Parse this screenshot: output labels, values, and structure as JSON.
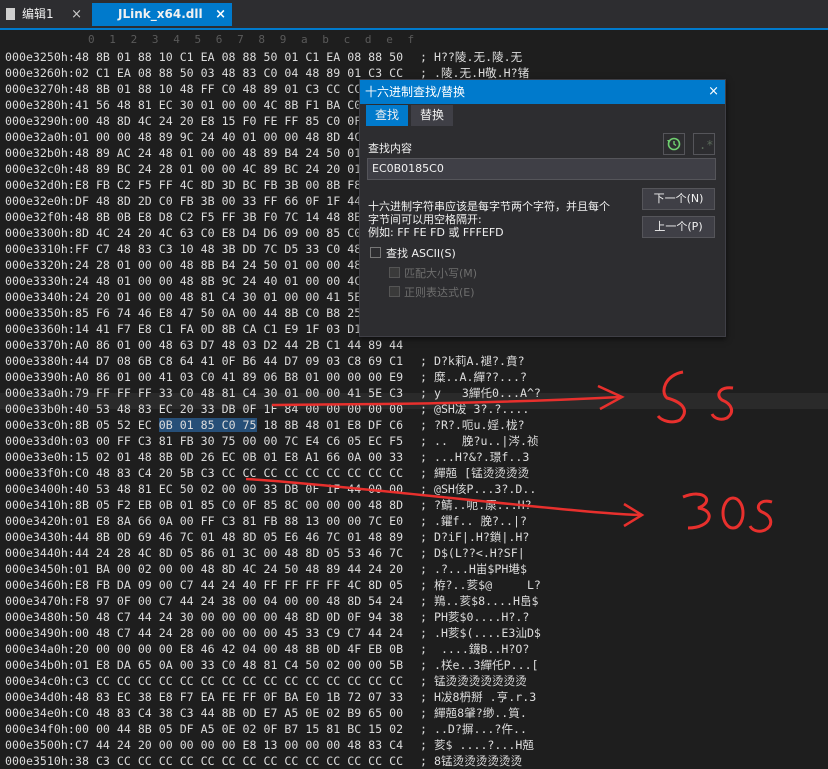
{
  "tabs": [
    {
      "label": "编辑1",
      "close": "×"
    },
    {
      "label": "JLink_x64.dll",
      "close": "×"
    }
  ],
  "ruler": [
    "0",
    "1",
    "2",
    "3",
    "4",
    "5",
    "6",
    "7",
    "8",
    "9",
    "a",
    "b",
    "c",
    "d",
    "e",
    "f"
  ],
  "rows": [
    {
      "o": "000e3250h:",
      "h": "48 8B 01 88 10 C1 EA 08 88 50 01 C1 EA 08 88 50",
      "a": "; H??陵.无.陵.无"
    },
    {
      "o": "000e3260h:",
      "h": "02 C1 EA 08 88 50 03 48 83 C0 04 48 89 01 C3 CC",
      "a": "; .陵.无.H敬.H?锗"
    },
    {
      "o": "000e3270h:",
      "h": "48 8B 01 88 10 48 FF C0 48 89 01 C3 CC CC CC CC",
      "a": ""
    },
    {
      "o": "000e3280h:",
      "h": "41 56 48 81 EC 30 01 00 00 4C 8B F1 BA C0 00 00",
      "a": ""
    },
    {
      "o": "000e3290h:",
      "h": "00 48 8D 4C 24 20 E8 15 F0 FE FF 85 C0 0F 84 00",
      "a": ""
    },
    {
      "o": "000e32a0h:",
      "h": "01 00 00 48 89 9C 24 40 01 00 00 48 8D 4C 24 20",
      "a": ""
    },
    {
      "o": "000e32b0h:",
      "h": "48 89 AC 24 48 01 00 00 48 89 B4 24 50 01 00 00",
      "a": ""
    },
    {
      "o": "000e32c0h:",
      "h": "48 89 BC 24 28 01 00 00 4C 89 BC 24 20 01 00 00",
      "a": ""
    },
    {
      "o": "000e32d0h:",
      "h": "E8 FB C2 F5 FF 4C 8D 3D BC FB 3B 00 8B F8 85 C0",
      "a": ""
    },
    {
      "o": "000e32e0h:",
      "h": "DF 48 8D 2D C0 FB 3B 00 33 FF 66 0F 1F 44 00 00",
      "a": ""
    },
    {
      "o": "000e32f0h:",
      "h": "48 8B 0B E8 D8 C2 F5 FF 3B F0 7C 14 48 8B 0B 8B",
      "a": ""
    },
    {
      "o": "000e3300h:",
      "h": "8D 4C 24 20 4C 63 C0 E8 D4 D6 09 00 85 C0 75 05",
      "a": ""
    },
    {
      "o": "000e3310h:",
      "h": "FF C7 48 83 C3 10 48 3B DD 7C D5 33 C0 48 8B 8C",
      "a": ""
    },
    {
      "o": "000e3320h:",
      "h": "24 28 01 00 00 48 8B B4 24 50 01 00 00 48 8B AC",
      "a": ""
    },
    {
      "o": "000e3330h:",
      "h": "24 48 01 00 00 48 8B 9C 24 40 01 00 00 4C 8B BC",
      "a": ""
    },
    {
      "o": "000e3340h:",
      "h": "24 20 01 00 00 48 81 C4 30 01 00 00 41 5E C3 CC",
      "a": ""
    },
    {
      "o": "000e3350h:",
      "h": "85 F6 74 46 E8 47 50 0A 00 44 8B C0 B8 25 49 92",
      "a": ""
    },
    {
      "o": "000e3360h:",
      "h": "14 41 F7 E8 C1 FA 0D 8B CA C1 E9 1F 03 D1 69 CA",
      "a": ""
    },
    {
      "o": "000e3370h:",
      "h": "A0 86 01 00 48 63 D7 48 03 D2 44 2B C1 44 89 44",
      "a": ""
    },
    {
      "o": "000e3380h:",
      "h": "44 D7 08 6B C8 64 41 0F B6 44 D7 09 03 C8 69 C1",
      "a": "; D?k莉A.褪?.賁?"
    },
    {
      "o": "000e3390h:",
      "h": "A0 86 01 00 41 03 C0 41 89 06 B8 01 00 00 00 E9",
      "a": "; 糜..A.繟??...?"
    },
    {
      "o": "000e33a0h:",
      "h": "79 FF FF FF 33 C0 48 81 C4 30 01 00 00 41 5E C3",
      "a": "; y   3繟仛0...A^?"
    },
    {
      "o": "000e33b0h:",
      "h": "40 53 48 83 EC 20 33 DB 0F 1F 84 00 00 00 00 00",
      "a": "; @SH冹 3?.?...."
    },
    {
      "o": "000e33c0h:",
      "h": "8B 05 52 EC 0B 01 85 C0 75 18 8B 48 01 E8 DF C6",
      "a": "; ?R?.呃u.婬.栊?"
    },
    {
      "o": "000e33d0h:",
      "h": "03 00 FF C3 81 FB 30 75 00 00 7C E4 C6 05 EC F5",
      "a": "; ..  脕?u..|涔.祯"
    },
    {
      "o": "000e33e0h:",
      "h": "15 02 01 48 8B 0D 26 EC 0B 01 E8 A1 66 0A 00 33",
      "a": "; ...H?&?.璟f..3"
    },
    {
      "o": "000e33f0h:",
      "h": "C0 48 83 C4 20 5B C3 CC CC CC CC CC CC CC CC CC",
      "a": "; 繟兡 [锰烫烫烫烫"
    },
    {
      "o": "000e3400h:",
      "h": "40 53 48 81 EC 50 02 00 00 33 DB 0F 1F 44 00 00",
      "a": "; @SH侅P...3?.D.."
    },
    {
      "o": "000e3410h:",
      "h": "8B 05 F2 EB 0B 01 85 C0 0F 85 8C 00 00 00 48 8D",
      "a": "; ?鲭..呃.厡...H?"
    },
    {
      "o": "000e3420h:",
      "h": "01 E8 8A 66 0A 00 FF C3 81 FB 88 13 00 00 7C E0",
      "a": "; .鑺f.. 脕?..|?"
    },
    {
      "o": "000e3430h:",
      "h": "44 8B 0D 69 46 7C 01 48 8D 05 E6 46 7C 01 48 89",
      "a": "; D?iF|.H?鎖|.H?"
    },
    {
      "o": "000e3440h:",
      "h": "44 24 28 4C 8D 05 86 01 3C 00 48 8D 05 53 46 7C",
      "a": "; D$(L??<.H?SF|"
    },
    {
      "o": "000e3450h:",
      "h": "01 BA 00 02 00 00 48 8D 4C 24 50 48 89 44 24 20",
      "a": "; .?...H峀$PH塂$"
    },
    {
      "o": "000e3460h:",
      "h": "E8 FB DA 09 00 C7 44 24 40 FF FF FF FF 4C 8D 05",
      "a": "; 栫?..荄$@     L?"
    },
    {
      "o": "000e3470h:",
      "h": "F8 97 0F 00 C7 44 24 38 00 04 00 00 48 8D 54 24",
      "a": "; 鴹..荄$8....H峊$"
    },
    {
      "o": "000e3480h:",
      "h": "50 48 C7 44 24 30 00 00 00 00 48 8D 0D 0F 94 38",
      "a": "; PH荄$0....H?.?"
    },
    {
      "o": "000e3490h:",
      "h": "00 48 C7 44 24 28 00 00 00 00 45 33 C9 C7 44 24",
      "a": "; .H荄$(....E3汕D$"
    },
    {
      "o": "000e34a0h:",
      "h": "20 00 00 00 00 E8 46 42 04 00 48 8B 0D 4F EB 0B",
      "a": ";  ....鑖B..H?O?"
    },
    {
      "o": "000e34b0h:",
      "h": "01 E8 DA 65 0A 00 33 C0 48 81 C4 50 02 00 00 5B",
      "a": "; .栚e..3繟仛P...["
    },
    {
      "o": "000e34c0h:",
      "h": "C3 CC CC CC CC CC CC CC CC CC CC CC CC CC CC CC",
      "a": "; 锰烫烫烫烫烫烫烫"
    },
    {
      "o": "000e34d0h:",
      "h": "48 83 EC 38 E8 F7 EA FE FF 0F BA E0 1B 72 07 33",
      "a": "; H冹8枬掰 .亨.r.3"
    },
    {
      "o": "000e34e0h:",
      "h": "C0 48 83 C4 38 C3 44 8B 0D E7 A5 0E 02 B9 65 00",
      "a": "; 繟兡8肈?缈..筫."
    },
    {
      "o": "000e34f0h:",
      "h": "00 00 44 8B 05 DF A5 0E 02 0F B7 15 81 BC 15 02",
      "a": "; ..D?摒...?仵.."
    },
    {
      "o": "000e3500h:",
      "h": "C7 44 24 20 00 00 00 00 E8 13 00 00 00 48 83 C4",
      "a": "; 荄$ ....?...H兡"
    },
    {
      "o": "000e3510h:",
      "h": "38 C3 CC CC CC CC CC CC CC CC CC CC CC CC CC CC",
      "a": "; 8锰烫烫烫烫烫烫"
    }
  ],
  "dialog": {
    "title": "十六进制查找/替换",
    "close": "×",
    "tab_find": "查找",
    "tab_replace": "替换",
    "find_label": "查找内容",
    "find_value": "EC0B0185C0",
    "help": "十六进制字符串应该是每字节两个字符，并且每个字节间可以用空格隔开:",
    "example": "例如: FF FE FD 或 FFFEFD",
    "next_button": "下一个(N)",
    "prev_button": "上一个(P)",
    "opt_ascii": "查找 ASCII(S)",
    "opt_case": "匹配大小写(M)",
    "opt_regex": "正则表达式(E)",
    "history_icon": "history-icon",
    "regex_icon": "regex-icon"
  },
  "annotations": {
    "note_top": "5s",
    "note_bottom": "30s"
  },
  "colors": {
    "accent": "#007acc",
    "annotation": "#e8302d"
  }
}
